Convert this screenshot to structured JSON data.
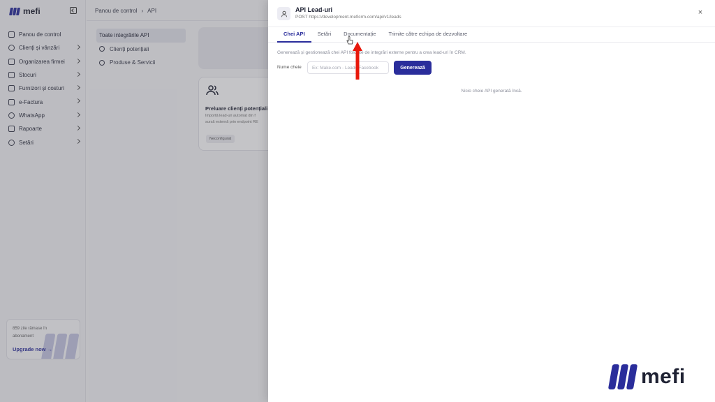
{
  "app": {
    "logo_text": "mefi"
  },
  "sidebar": {
    "items": [
      {
        "label": "Panou de control",
        "icon": "home-icon",
        "chevron": false
      },
      {
        "label": "Clienți și vânzări",
        "icon": "users-icon",
        "chevron": true
      },
      {
        "label": "Organizarea firmei",
        "icon": "org-icon",
        "chevron": true
      },
      {
        "label": "Stocuri",
        "icon": "box-icon",
        "chevron": true
      },
      {
        "label": "Furnizori și costuri",
        "icon": "supplier-icon",
        "chevron": true
      },
      {
        "label": "e-Factura",
        "icon": "invoice-icon",
        "chevron": true
      },
      {
        "label": "WhatsApp",
        "icon": "whatsapp-icon",
        "chevron": true
      },
      {
        "label": "Rapoarte",
        "icon": "report-icon",
        "chevron": true
      },
      {
        "label": "Setări",
        "icon": "gear-icon",
        "chevron": true
      }
    ],
    "upgrade": {
      "text": "859 zile rămase în abonament",
      "link": "Upgrade now"
    }
  },
  "topbar": {
    "breadcrumb": [
      "Panou de control",
      "API"
    ]
  },
  "subnav": {
    "items": [
      {
        "label": "Toate integrările API",
        "active": true
      },
      {
        "label": "Clienți potențiali",
        "active": false
      },
      {
        "label": "Produse & Servicii",
        "active": false
      }
    ]
  },
  "card": {
    "title": "Preluare clienți potențiali",
    "desc_line1": "Importă lead-uri automat din f",
    "desc_line2": "sursă externă prin endpoint RE",
    "badge": "Neconfigurat"
  },
  "drawer": {
    "title": "API Lead-uri",
    "subtitle": "POST https://development.meficrm.com/api/v1/leads",
    "tabs": [
      {
        "label": "Chei API",
        "active": true
      },
      {
        "label": "Setări",
        "active": false
      },
      {
        "label": "Documentație",
        "active": false
      },
      {
        "label": "Trimite către echipa de dezvoltare",
        "active": false
      }
    ],
    "description": "Generează și gestionează chei API folosite de integrări externe pentru a crea lead-uri în CRM.",
    "key_label": "Nume cheie",
    "key_placeholder": "Ex: Make.com - Leads Facebook",
    "key_value": "",
    "generate_label": "Generează",
    "empty_text": "Nicio cheie API generată încă."
  },
  "watermark": {
    "text": "mefi"
  },
  "colors": {
    "brand": "#2a2d9b",
    "annotation_arrow": "#e8180c"
  }
}
